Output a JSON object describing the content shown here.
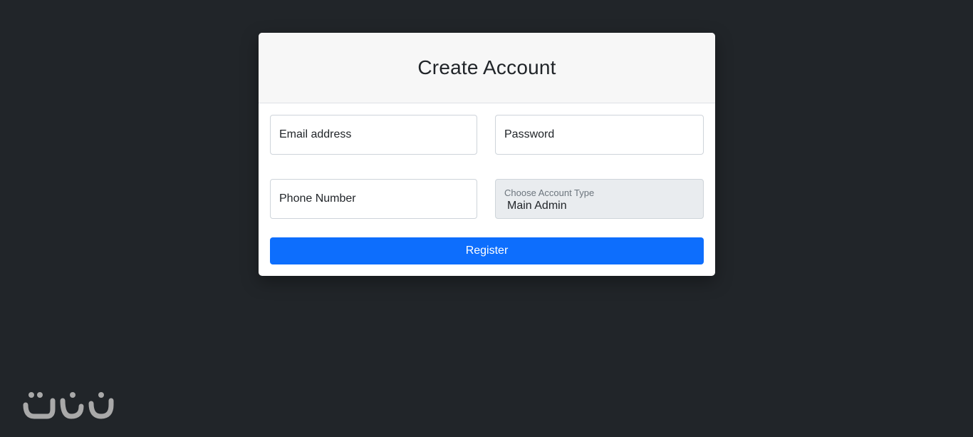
{
  "form": {
    "title": "Create Account",
    "email_placeholder": "Email address",
    "password_placeholder": "Password",
    "phone_placeholder": "Phone Number",
    "account_type_label": "Choose Account Type",
    "account_type_value": "Main Admin",
    "register_label": "Register"
  },
  "colors": {
    "background": "#212529",
    "primary": "#0d6efd",
    "header_bg": "#f7f7f7",
    "select_bg": "#e9ecef"
  },
  "watermark": {
    "icon": "brand-logo-icon"
  }
}
